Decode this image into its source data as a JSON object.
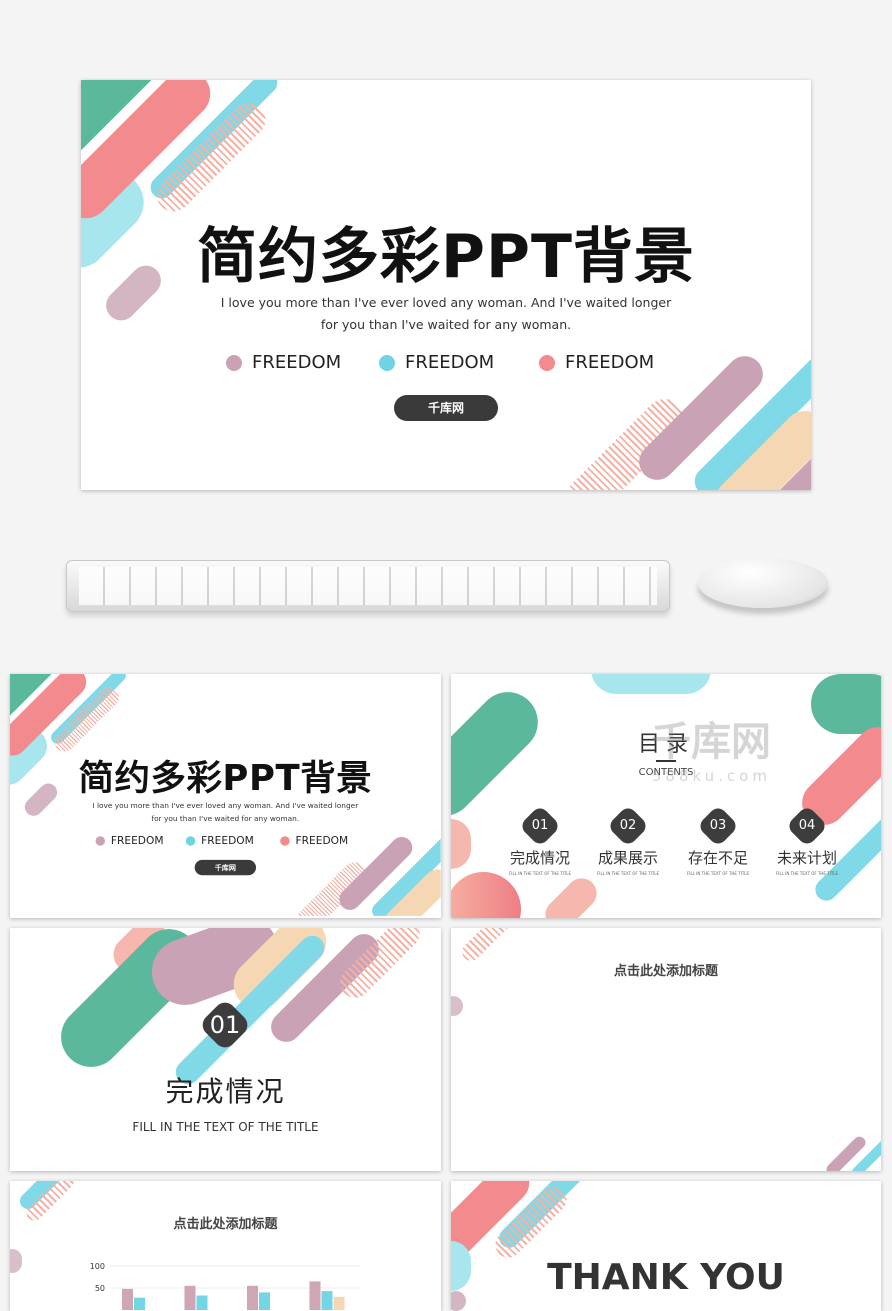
{
  "cover": {
    "title": "简约多彩PPT背景",
    "subtitle_line1": "I love you more than I've ever loved any woman. And I've waited longer",
    "subtitle_line2": "for you than I've waited for any woman.",
    "freedom": [
      {
        "label": "FREEDOM",
        "color": "#c9a2b5"
      },
      {
        "label": "FREEDOM",
        "color": "#6fd3e2"
      },
      {
        "label": "FREEDOM",
        "color": "#f28a8e"
      }
    ],
    "button": "千库网"
  },
  "watermark": {
    "brand": "千库网",
    "url": "588ku.com"
  },
  "toc": {
    "title": "目录",
    "subtitle": "CONTENTS",
    "items": [
      {
        "num": "01",
        "title": "完成情况",
        "sub": "FILL IN THE TEXT OF THE TITLE"
      },
      {
        "num": "02",
        "title": "成果展示",
        "sub": "FILL IN THE TEXT OF THE TITLE"
      },
      {
        "num": "03",
        "title": "存在不足",
        "sub": "FILL IN THE TEXT OF THE TITLE"
      },
      {
        "num": "04",
        "title": "未来计划",
        "sub": "FILL IN THE TEXT OF THE TITLE"
      }
    ]
  },
  "section": {
    "num": "01",
    "title": "完成情况",
    "sub": "FILL IN THE TEXT OF THE TITLE"
  },
  "blank": {
    "title": "点击此处添加标题"
  },
  "chart_slide": {
    "title": "点击此处添加标题"
  },
  "thanks": {
    "title": "THANK YOU"
  },
  "chart_data": {
    "type": "bar",
    "ylim": [
      0,
      100
    ],
    "yticks": [
      "100",
      "50"
    ],
    "categories": [
      "",
      "",
      "",
      ""
    ],
    "series": [
      {
        "color": "#cfa6b6",
        "values": [
          48,
          55,
          55,
          65
        ]
      },
      {
        "color": "#74d6e4",
        "values": [
          28,
          33,
          40,
          43
        ]
      },
      {
        "color": "#f6d7b3",
        "values": [
          null,
          null,
          null,
          30
        ]
      }
    ],
    "grid": true
  }
}
